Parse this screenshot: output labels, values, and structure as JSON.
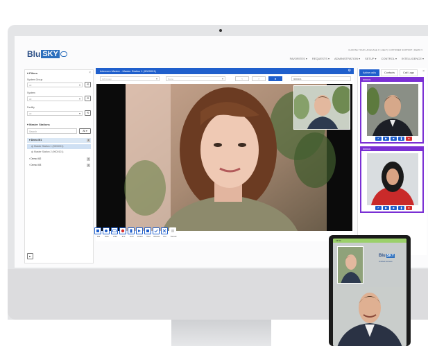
{
  "app": {
    "logo_prefix": "Blu",
    "logo_brand": "SKY",
    "top_links": "CHOOSE YOUR LANGUAGE ▾  |  HELP  |  CUSTOMER SUPPORT  |  DEMO ▾",
    "nav": [
      "FAVORITES ▾",
      "REQUESTS ▾",
      "ADMINISTRATION ▾",
      "SETUP ▾",
      "CONTROL ▾",
      "INTELLIGENCE ▾"
    ]
  },
  "filters": {
    "title": "Filters",
    "system_group_label": "System Group",
    "system_label": "System",
    "facility_label": "Facility",
    "select_all": "All",
    "master_stations_title": "Master Stations",
    "search_placeholder": "Search",
    "all_button": "All ▾",
    "tree": [
      {
        "label": "Demo M1",
        "count": "2"
      },
      {
        "label": "Master Station 1 (9000001)"
      },
      {
        "label": "Master Station 2 (9000101)"
      },
      {
        "label": "Demo M2",
        "count": "2"
      },
      {
        "label": "Demo M3",
        "count": "2"
      }
    ]
  },
  "intercom": {
    "title": "Intercom Master - Master Station 1 (9000001)",
    "group_placeholder": "Gift Group",
    "name_placeholder": "Name",
    "station_value": "9000101",
    "tools": [
      "Dial",
      "Mute",
      "Video",
      "End",
      "Door",
      "Enable",
      "Hold",
      "Release",
      "Rec.",
      "Transfer"
    ]
  },
  "calls": {
    "tabs": [
      "Active calls",
      "Contacts",
      "Call Logs"
    ],
    "cards": [
      {
        "id": "9000101"
      },
      {
        "id": "9000101"
      }
    ]
  },
  "phone": {
    "status": "12:34",
    "logo_prefix": "Blu",
    "logo_brand": "SKY",
    "logo_tag": "Unified Access"
  },
  "colors": {
    "accent": "#1f5fcc",
    "call_border": "#7a2fd4",
    "end_call": "#d42e2e"
  }
}
